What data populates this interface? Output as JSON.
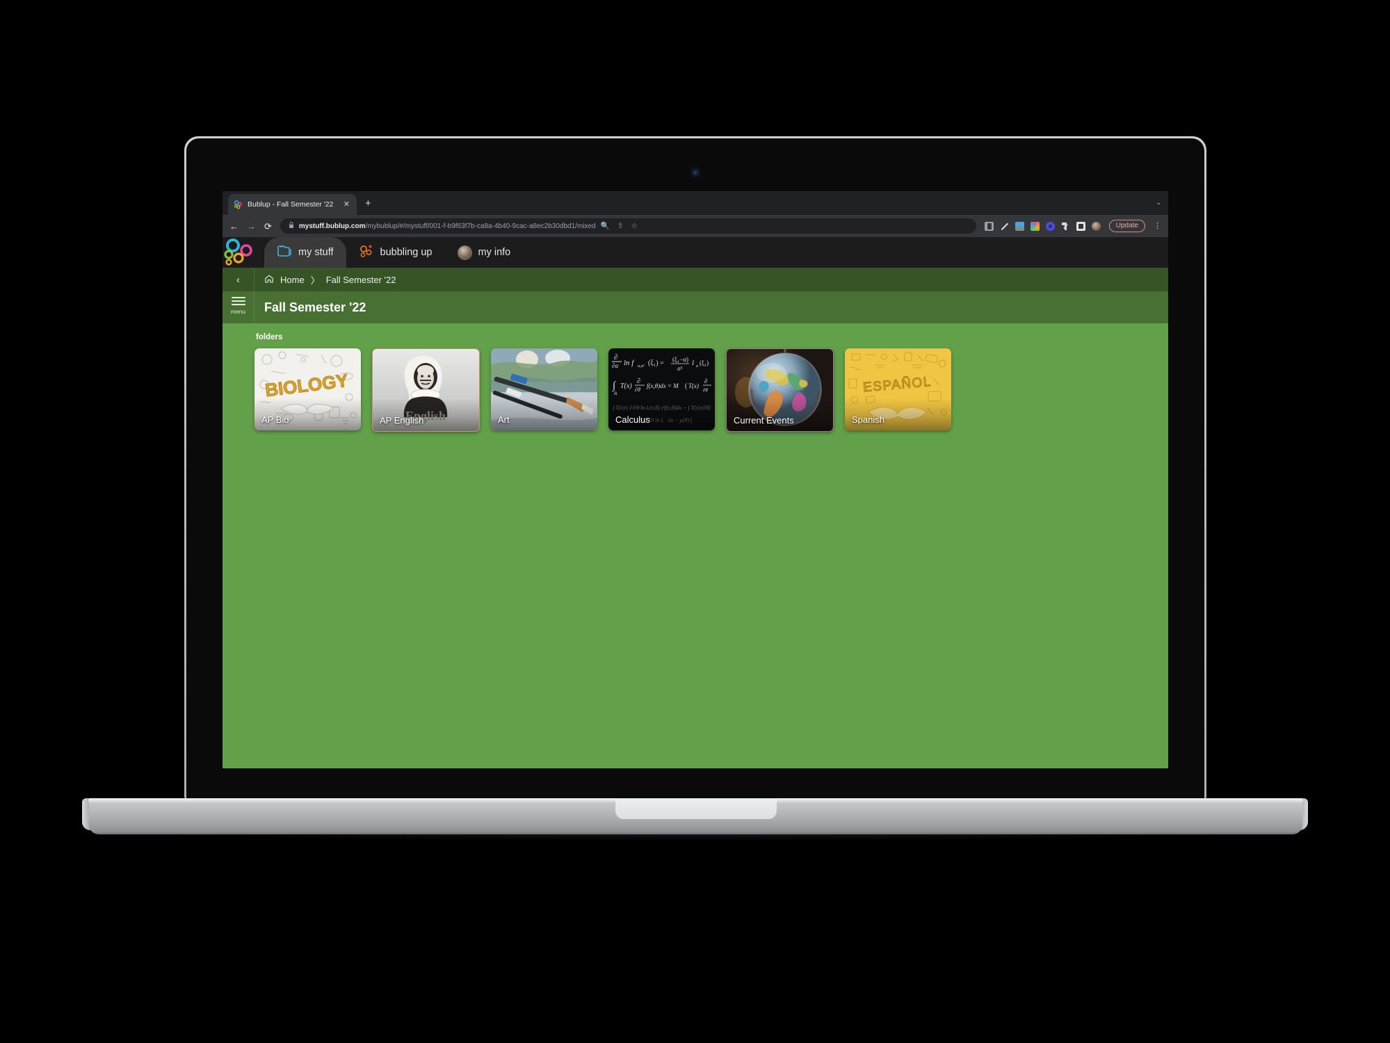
{
  "browser": {
    "tab": {
      "favicon": "bublup-logo-icon",
      "title": "Bublup - Fall Semester '22",
      "close": "✕"
    },
    "new_tab": "+",
    "tab_list_chevron": "⌄",
    "nav": {
      "back": "←",
      "forward": "→",
      "reload": "⟳"
    },
    "omnibox": {
      "lock_icon": "lock-icon",
      "domain": "mystuff.bublup.com",
      "path": "/mybublup/#/mystuff/001-f-b9f63f7b-ca8a-4b40-9cac-a8ec2b30dbd1/mixed",
      "actions": [
        "search-icon",
        "share-icon",
        "bookmark-star-icon"
      ]
    },
    "extensions": [
      "screenshot-icon",
      "pen-icon",
      "us-flag-icon",
      "photos-icon",
      "gear-icon",
      "puzzle-icon",
      "window-icon",
      "profile-avatar-icon"
    ],
    "update_button": "Update",
    "kebab_menu": "⋮"
  },
  "app": {
    "logo": "bublup-logo-icon",
    "tabs": [
      {
        "id": "my-stuff",
        "label": "my stuff",
        "icon": "folders-icon",
        "active": true
      },
      {
        "id": "bubbling-up",
        "label": "bubbling up",
        "icon": "bubbles-icon",
        "active": false
      },
      {
        "id": "my-info",
        "label": "my info",
        "icon": "user-avatar-icon",
        "active": false
      }
    ],
    "breadcrumb": {
      "back_icon": "‹",
      "home_icon": "home-icon",
      "home": "Home",
      "separator": "〉",
      "current": "Fall Semester '22"
    },
    "menu_label": "menu",
    "page_title": "Fall Semester '22",
    "section_label": "folders",
    "folders": [
      {
        "name": "AP Bio",
        "art": "biology-doodles"
      },
      {
        "name": "AP English",
        "art": "shakespeare-portrait"
      },
      {
        "name": "Art",
        "art": "paintbrushes"
      },
      {
        "name": "Calculus",
        "art": "blackboard-equations"
      },
      {
        "name": "Current Events",
        "art": "globe"
      },
      {
        "name": "Spanish",
        "art": "espanol-doodles"
      }
    ]
  },
  "colors": {
    "breadcrumb_green": "#365426",
    "title_green": "#477032",
    "body_green": "#62a04a",
    "app_bar": "#1c1c1c",
    "update_accent": "#f0a9a2"
  }
}
